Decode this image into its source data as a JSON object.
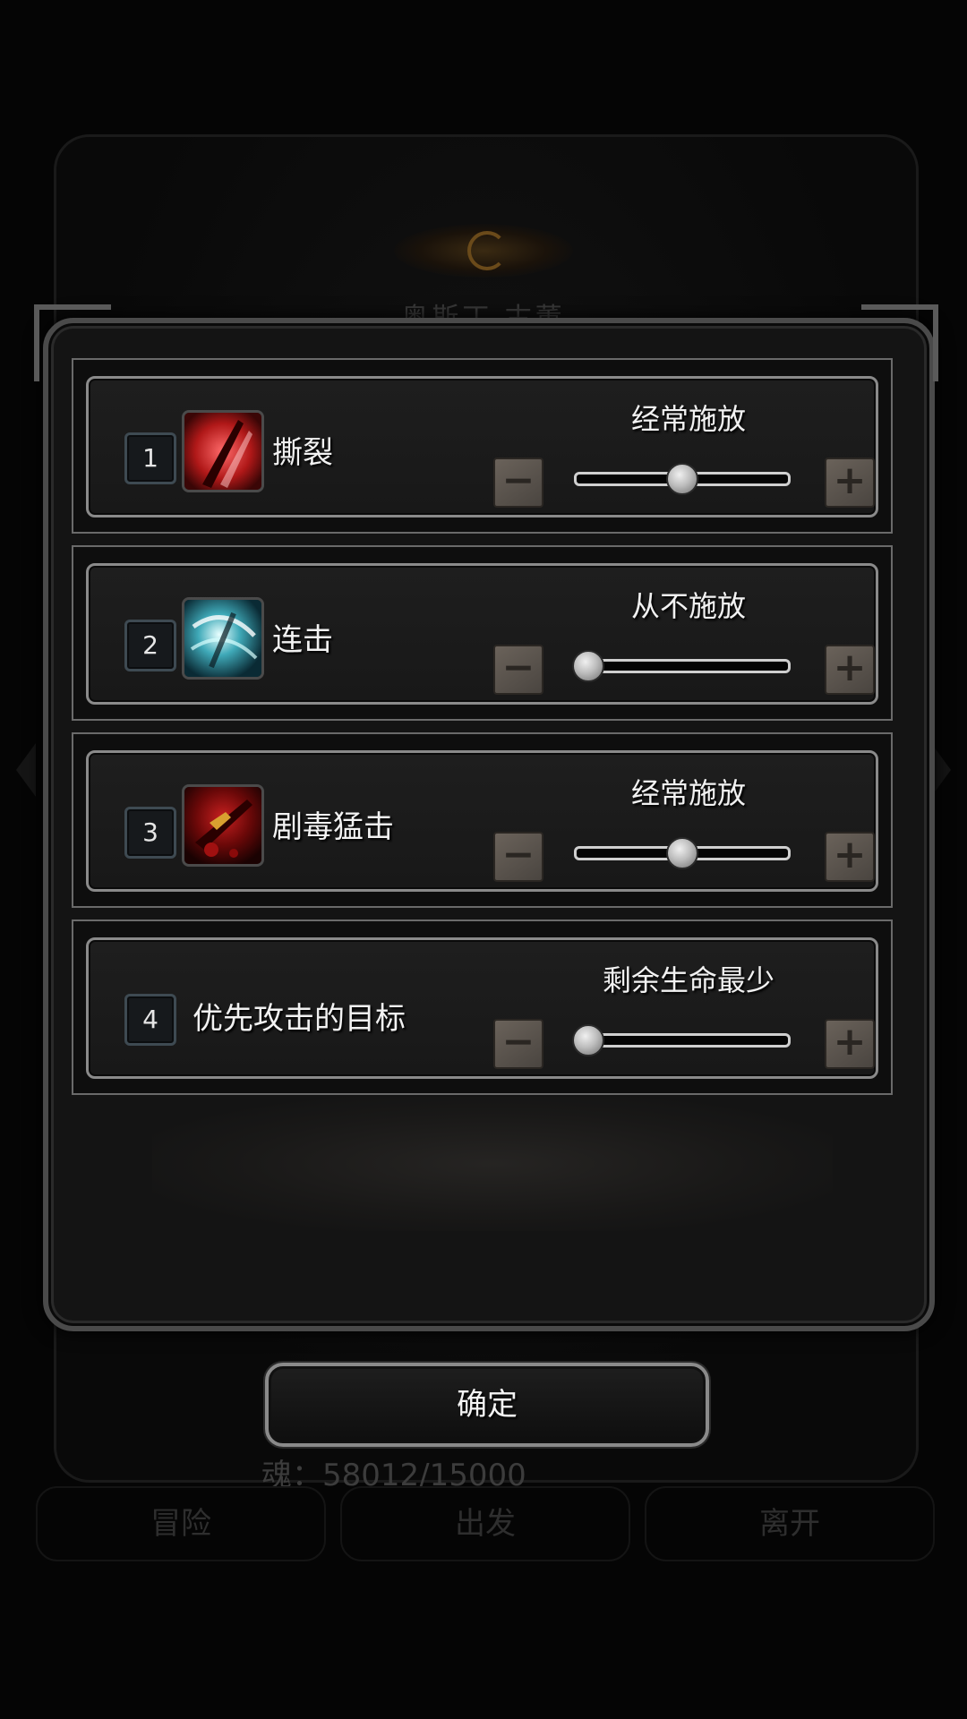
{
  "background": {
    "title": "奥斯丁 古董",
    "soul": "魂：58012/15000",
    "tabs": [
      "冒险",
      "出发",
      "离开"
    ]
  },
  "dialog": {
    "rows": [
      {
        "num": "1",
        "name": "撕裂",
        "setting": "经常施放",
        "level": 0.5,
        "icon": "tear-skill-icon"
      },
      {
        "num": "2",
        "name": "连击",
        "setting": "从不施放",
        "level": 0.0,
        "icon": "combo-skill-icon"
      },
      {
        "num": "3",
        "name": "剧毒猛击",
        "setting": "经常施放",
        "level": 0.5,
        "icon": "venom-strike-skill-icon"
      },
      {
        "num": "4",
        "name": "优先攻击的目标",
        "setting": "剩余生命最少",
        "level": 0.0
      }
    ],
    "minus_symbol": "−",
    "plus_symbol": "+",
    "confirm_label": "确定"
  },
  "colors": {
    "panel": "#141414",
    "border": "#8a8a8a",
    "text": "#f2f2f2",
    "stepper": "#5a534c"
  }
}
